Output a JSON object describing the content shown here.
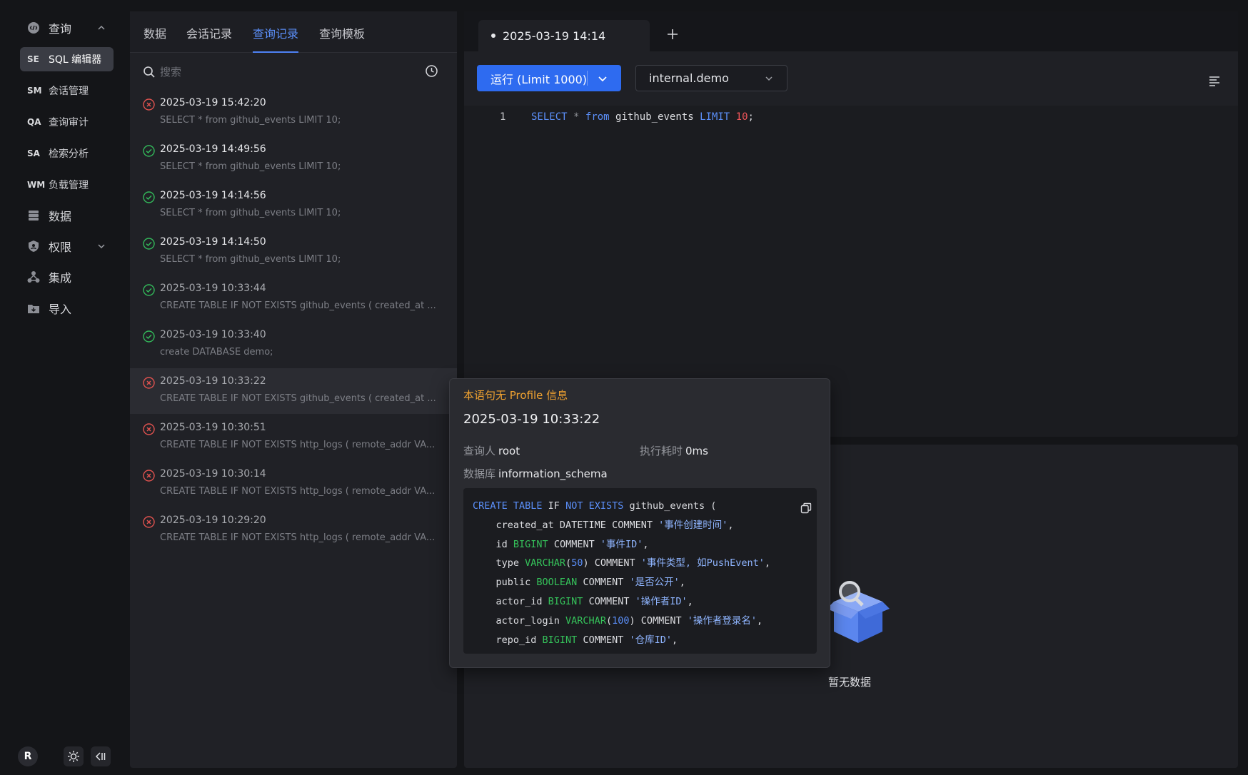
{
  "nav": {
    "query": "查询",
    "subitems": [
      {
        "abbr": "SE",
        "label": "SQL 编辑器",
        "active": true
      },
      {
        "abbr": "SM",
        "label": "会话管理",
        "active": false
      },
      {
        "abbr": "QA",
        "label": "查询审计",
        "active": false
      },
      {
        "abbr": "SA",
        "label": "检索分析",
        "active": false
      },
      {
        "abbr": "WM",
        "label": "负载管理",
        "active": false
      }
    ],
    "data": "数据",
    "permission": "权限",
    "integration": "集成",
    "import": "导入",
    "avatar": "R"
  },
  "panel": {
    "tabs": [
      "数据",
      "会话记录",
      "查询记录",
      "查询模板"
    ],
    "active_tab": "查询记录",
    "search_placeholder": "搜索",
    "history": [
      {
        "time": "2025-03-19 15:42:20",
        "status": "failed",
        "sql": "SELECT * from github_events LIMIT 10;"
      },
      {
        "time": "2025-03-19 14:49:56",
        "status": "success",
        "sql": "SELECT * from github_events LIMIT 10;"
      },
      {
        "time": "2025-03-19 14:14:56",
        "status": "success",
        "sql": "SELECT * from github_events LIMIT 10;"
      },
      {
        "time": "2025-03-19 14:14:50",
        "status": "success",
        "sql": "SELECT * from github_events LIMIT 10;"
      },
      {
        "time": "2025-03-19 10:33:44",
        "status": "success",
        "sql": "CREATE TABLE IF NOT EXISTS github_events ( created_at ..."
      },
      {
        "time": "2025-03-19 10:33:40",
        "status": "success",
        "sql": "create DATABASE demo;"
      },
      {
        "time": "2025-03-19 10:33:22",
        "status": "failed",
        "sql": "CREATE TABLE IF NOT EXISTS github_events ( created_at ..."
      },
      {
        "time": "2025-03-19 10:30:51",
        "status": "failed",
        "sql": "CREATE TABLE IF NOT EXISTS http_logs ( remote_addr VA..."
      },
      {
        "time": "2025-03-19 10:30:14",
        "status": "failed",
        "sql": "CREATE TABLE IF NOT EXISTS http_logs ( remote_addr VA..."
      },
      {
        "time": "2025-03-19 10:29:20",
        "status": "failed",
        "sql": "CREATE TABLE IF NOT EXISTS http_logs ( remote_addr VA..."
      }
    ]
  },
  "editor": {
    "tab_title": "2025-03-19 14:14",
    "run_label": "运行 (Limit 1000)",
    "database": "internal.demo",
    "line_number": "1",
    "code": {
      "select": "SELECT",
      "star": "*",
      "from": "from",
      "table": "github_events",
      "limit": "LIMIT",
      "n": "10",
      "semi": ";"
    }
  },
  "results": {
    "empty_text": "暂无数据"
  },
  "popover": {
    "warning": "本语句无 Profile 信息",
    "time": "2025-03-19 10:33:22",
    "user_label": "查询人",
    "user": "root",
    "duration_label": "执行耗时",
    "duration": "0ms",
    "db_label": "数据库",
    "db": "information_schema",
    "sql_lines": [
      [
        [
          "kw",
          "CREATE TABLE"
        ],
        [
          "tx",
          " IF "
        ],
        [
          "kw",
          "NOT EXISTS"
        ],
        [
          "tx",
          " github_events ("
        ]
      ],
      [
        [
          "tx",
          "    created_at DATETIME COMMENT "
        ],
        [
          "st",
          "'事件创建时间'"
        ],
        [
          "tx",
          ","
        ]
      ],
      [
        [
          "tx",
          "    id "
        ],
        [
          "ty",
          "BIGINT"
        ],
        [
          "tx",
          " COMMENT "
        ],
        [
          "st",
          "'事件ID'"
        ],
        [
          "tx",
          ","
        ]
      ],
      [
        [
          "tx",
          "    type "
        ],
        [
          "ty",
          "VARCHAR"
        ],
        [
          "tx",
          "("
        ],
        [
          "nm",
          "50"
        ],
        [
          "tx",
          ") COMMENT "
        ],
        [
          "st",
          "'事件类型, 如PushEvent'"
        ],
        [
          "tx",
          ","
        ]
      ],
      [
        [
          "tx",
          "    public "
        ],
        [
          "ty",
          "BOOLEAN"
        ],
        [
          "tx",
          " COMMENT "
        ],
        [
          "st",
          "'是否公开'"
        ],
        [
          "tx",
          ","
        ]
      ],
      [
        [
          "tx",
          "    actor_id "
        ],
        [
          "ty",
          "BIGINT"
        ],
        [
          "tx",
          " COMMENT "
        ],
        [
          "st",
          "'操作者ID'"
        ],
        [
          "tx",
          ","
        ]
      ],
      [
        [
          "tx",
          "    actor_login "
        ],
        [
          "ty",
          "VARCHAR"
        ],
        [
          "tx",
          "("
        ],
        [
          "nm",
          "100"
        ],
        [
          "tx",
          ") COMMENT "
        ],
        [
          "st",
          "'操作者登录名'"
        ],
        [
          "tx",
          ","
        ]
      ],
      [
        [
          "tx",
          "    repo_id "
        ],
        [
          "ty",
          "BIGINT"
        ],
        [
          "tx",
          " COMMENT "
        ],
        [
          "st",
          "'仓库ID'"
        ],
        [
          "tx",
          ","
        ]
      ]
    ]
  }
}
